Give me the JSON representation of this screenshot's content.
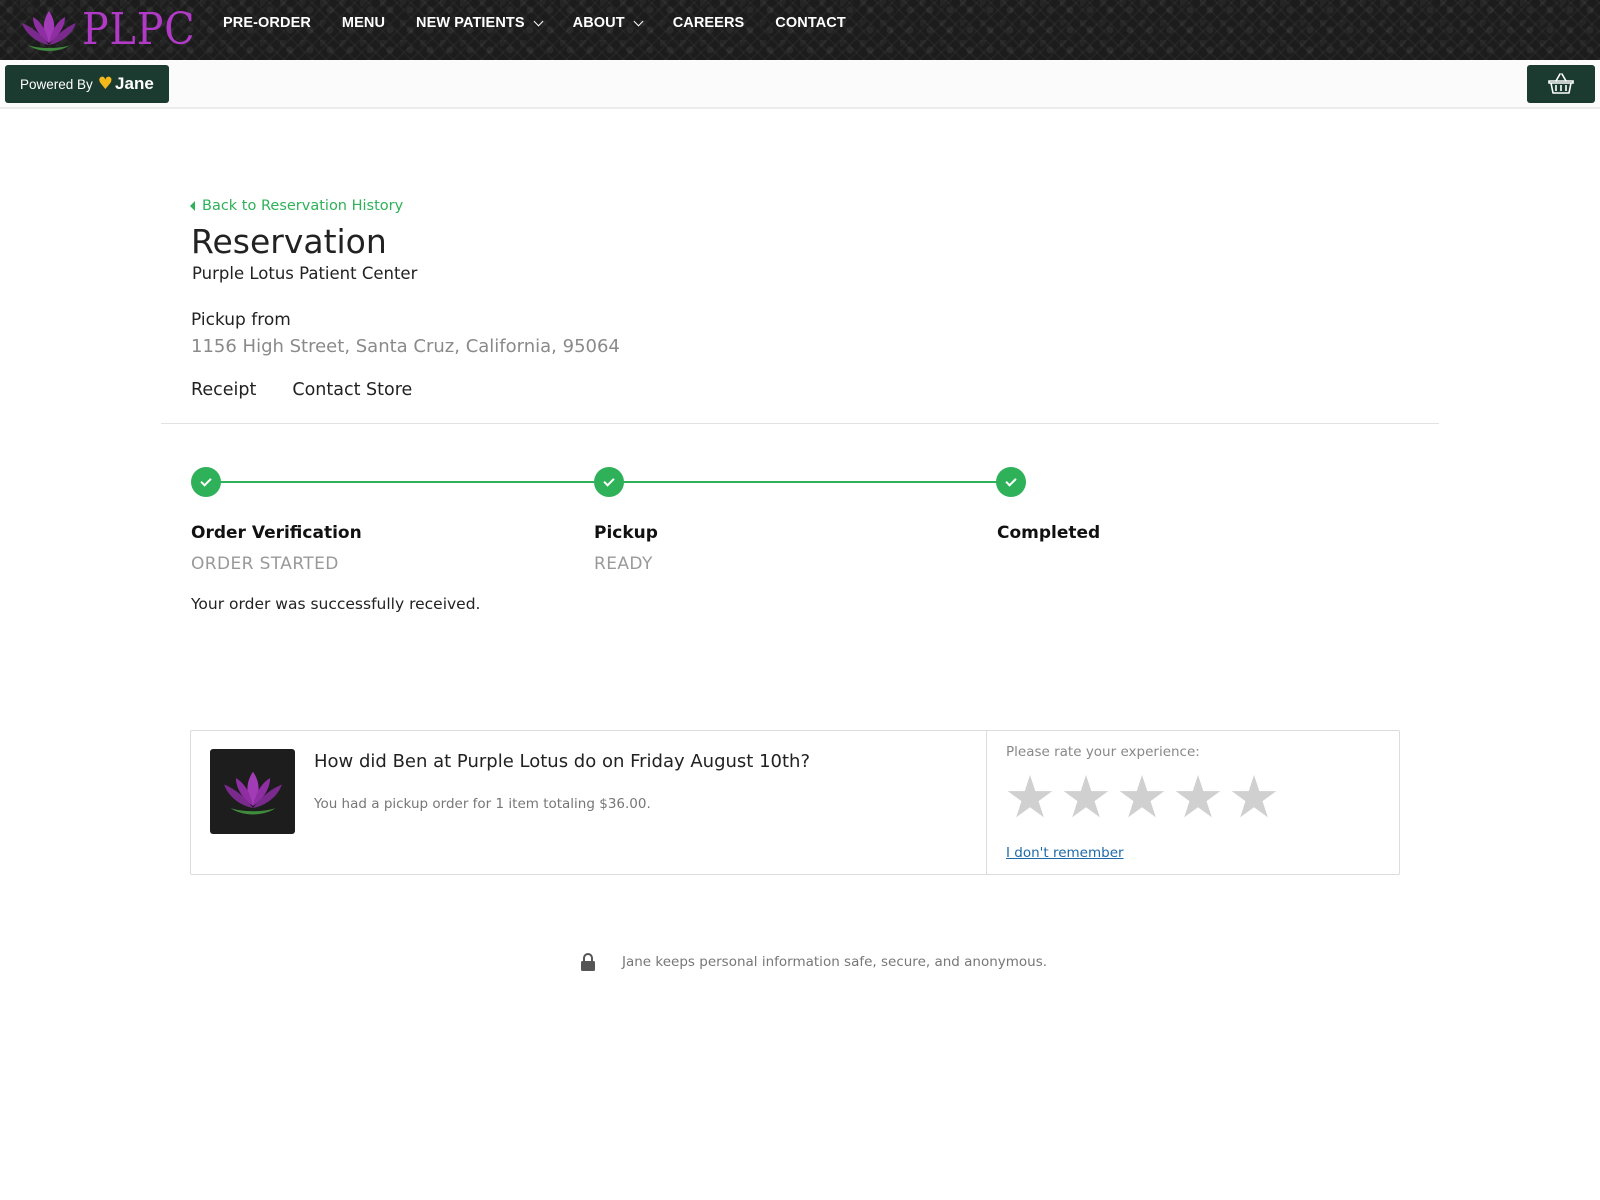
{
  "header": {
    "logo_text": "PLPC",
    "nav": [
      {
        "label": "PRE-ORDER",
        "has_dropdown": false
      },
      {
        "label": "MENU",
        "has_dropdown": false
      },
      {
        "label": "NEW PATIENTS",
        "has_dropdown": true
      },
      {
        "label": "ABOUT",
        "has_dropdown": true
      },
      {
        "label": "CAREERS",
        "has_dropdown": false
      },
      {
        "label": "CONTACT",
        "has_dropdown": false
      }
    ]
  },
  "subbar": {
    "powered_by": "Powered By",
    "brand": "Jane",
    "cart_icon": "basket-icon"
  },
  "reservation": {
    "back_link": "Back to Reservation History",
    "title": "Reservation",
    "store_name": "Purple Lotus Patient Center",
    "pickup_label": "Pickup from",
    "address": "1156 High Street, Santa Cruz, California, 95064",
    "tabs": [
      "Receipt",
      "Contact Store"
    ]
  },
  "progress": {
    "steps": [
      {
        "title": "Order Verification",
        "status": "ORDER STARTED",
        "complete": true
      },
      {
        "title": "Pickup",
        "status": "READY",
        "complete": true
      },
      {
        "title": "Completed",
        "status": "",
        "complete": true
      }
    ],
    "message": "Your order was successfully received."
  },
  "review": {
    "question": "How did Ben at Purple Lotus do on Friday August 10th?",
    "summary": "You had a pickup order for 1 item totaling $36.00.",
    "rate_label": "Please rate your experience:",
    "max_stars": 5,
    "rating": 0,
    "dont_remember": "I don't remember"
  },
  "footer": {
    "secure_text": "Jane keeps personal information safe, secure, and anonymous."
  },
  "colors": {
    "accent_green": "#2eb158",
    "dark_green": "#1b3a30",
    "brand_purple": "#b13ac6",
    "heart_yellow": "#f3b91b",
    "link_blue": "#1e6aa8"
  }
}
